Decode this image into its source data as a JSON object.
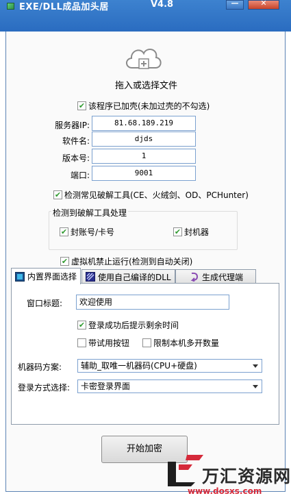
{
  "window": {
    "title": "EXE/DLL成品加头居",
    "version": "V4.8",
    "minimize_label": "—",
    "close_label": "✕"
  },
  "dropzone": {
    "label": "拖入或选择文件",
    "icon": "cloud-upload-icon"
  },
  "packed_check": {
    "label": "该程序已加壳(未加过壳的不勾选)",
    "checked": true
  },
  "fields": {
    "server_ip": {
      "label": "服务器IP:",
      "value": "81.68.189.219"
    },
    "software_name": {
      "label": "软件名:",
      "value": "djds"
    },
    "version_no": {
      "label": "版本号:",
      "value": "1"
    },
    "port": {
      "label": "端口:",
      "value": "9001"
    }
  },
  "detect_check": {
    "label": "检测常见破解工具(CE、火绒剑、OD、PCHunter)",
    "checked": true
  },
  "crack_group": {
    "title": "检测到破解工具处理",
    "ban_account": {
      "label": "封账号/卡号",
      "checked": true
    },
    "ban_machine": {
      "label": "封机器",
      "checked": true
    }
  },
  "vm_check": {
    "label": "虚拟机禁止运行(检测到自动关闭)",
    "checked": true
  },
  "tabs": [
    {
      "label": "内置界面选择",
      "icon": "monitor-icon",
      "active": true
    },
    {
      "label": "使用自己编译的DLL",
      "icon": "dll-icon",
      "active": false
    },
    {
      "label": "生成代理端",
      "icon": "proxy-icon",
      "active": false
    }
  ],
  "panel": {
    "window_title_label": "窗口标题:",
    "window_title_value": "欢迎使用",
    "show_remaining_time": {
      "label": "登录成功后提示剩余时间",
      "checked": true
    },
    "trial_button": {
      "label": "带试用按钮",
      "checked": false
    },
    "limit_multi": {
      "label": "限制本机多开数量",
      "checked": false
    },
    "machine_code_label": "机器码方案:",
    "machine_code_value": "辅助_取唯一机器码(CPU+硬盘)",
    "login_mode_label": "登录方式选择:",
    "login_mode_value": "卡密登录界面"
  },
  "start_button": "开始加密",
  "watermark": {
    "text": "万汇资源网",
    "url": "www.dosxs.com"
  },
  "colors": {
    "titlebar": "#2f72c6",
    "check_green": "#2f9a2f",
    "input_border": "#7aa0cf",
    "watermark_red": "#d52a3a"
  }
}
